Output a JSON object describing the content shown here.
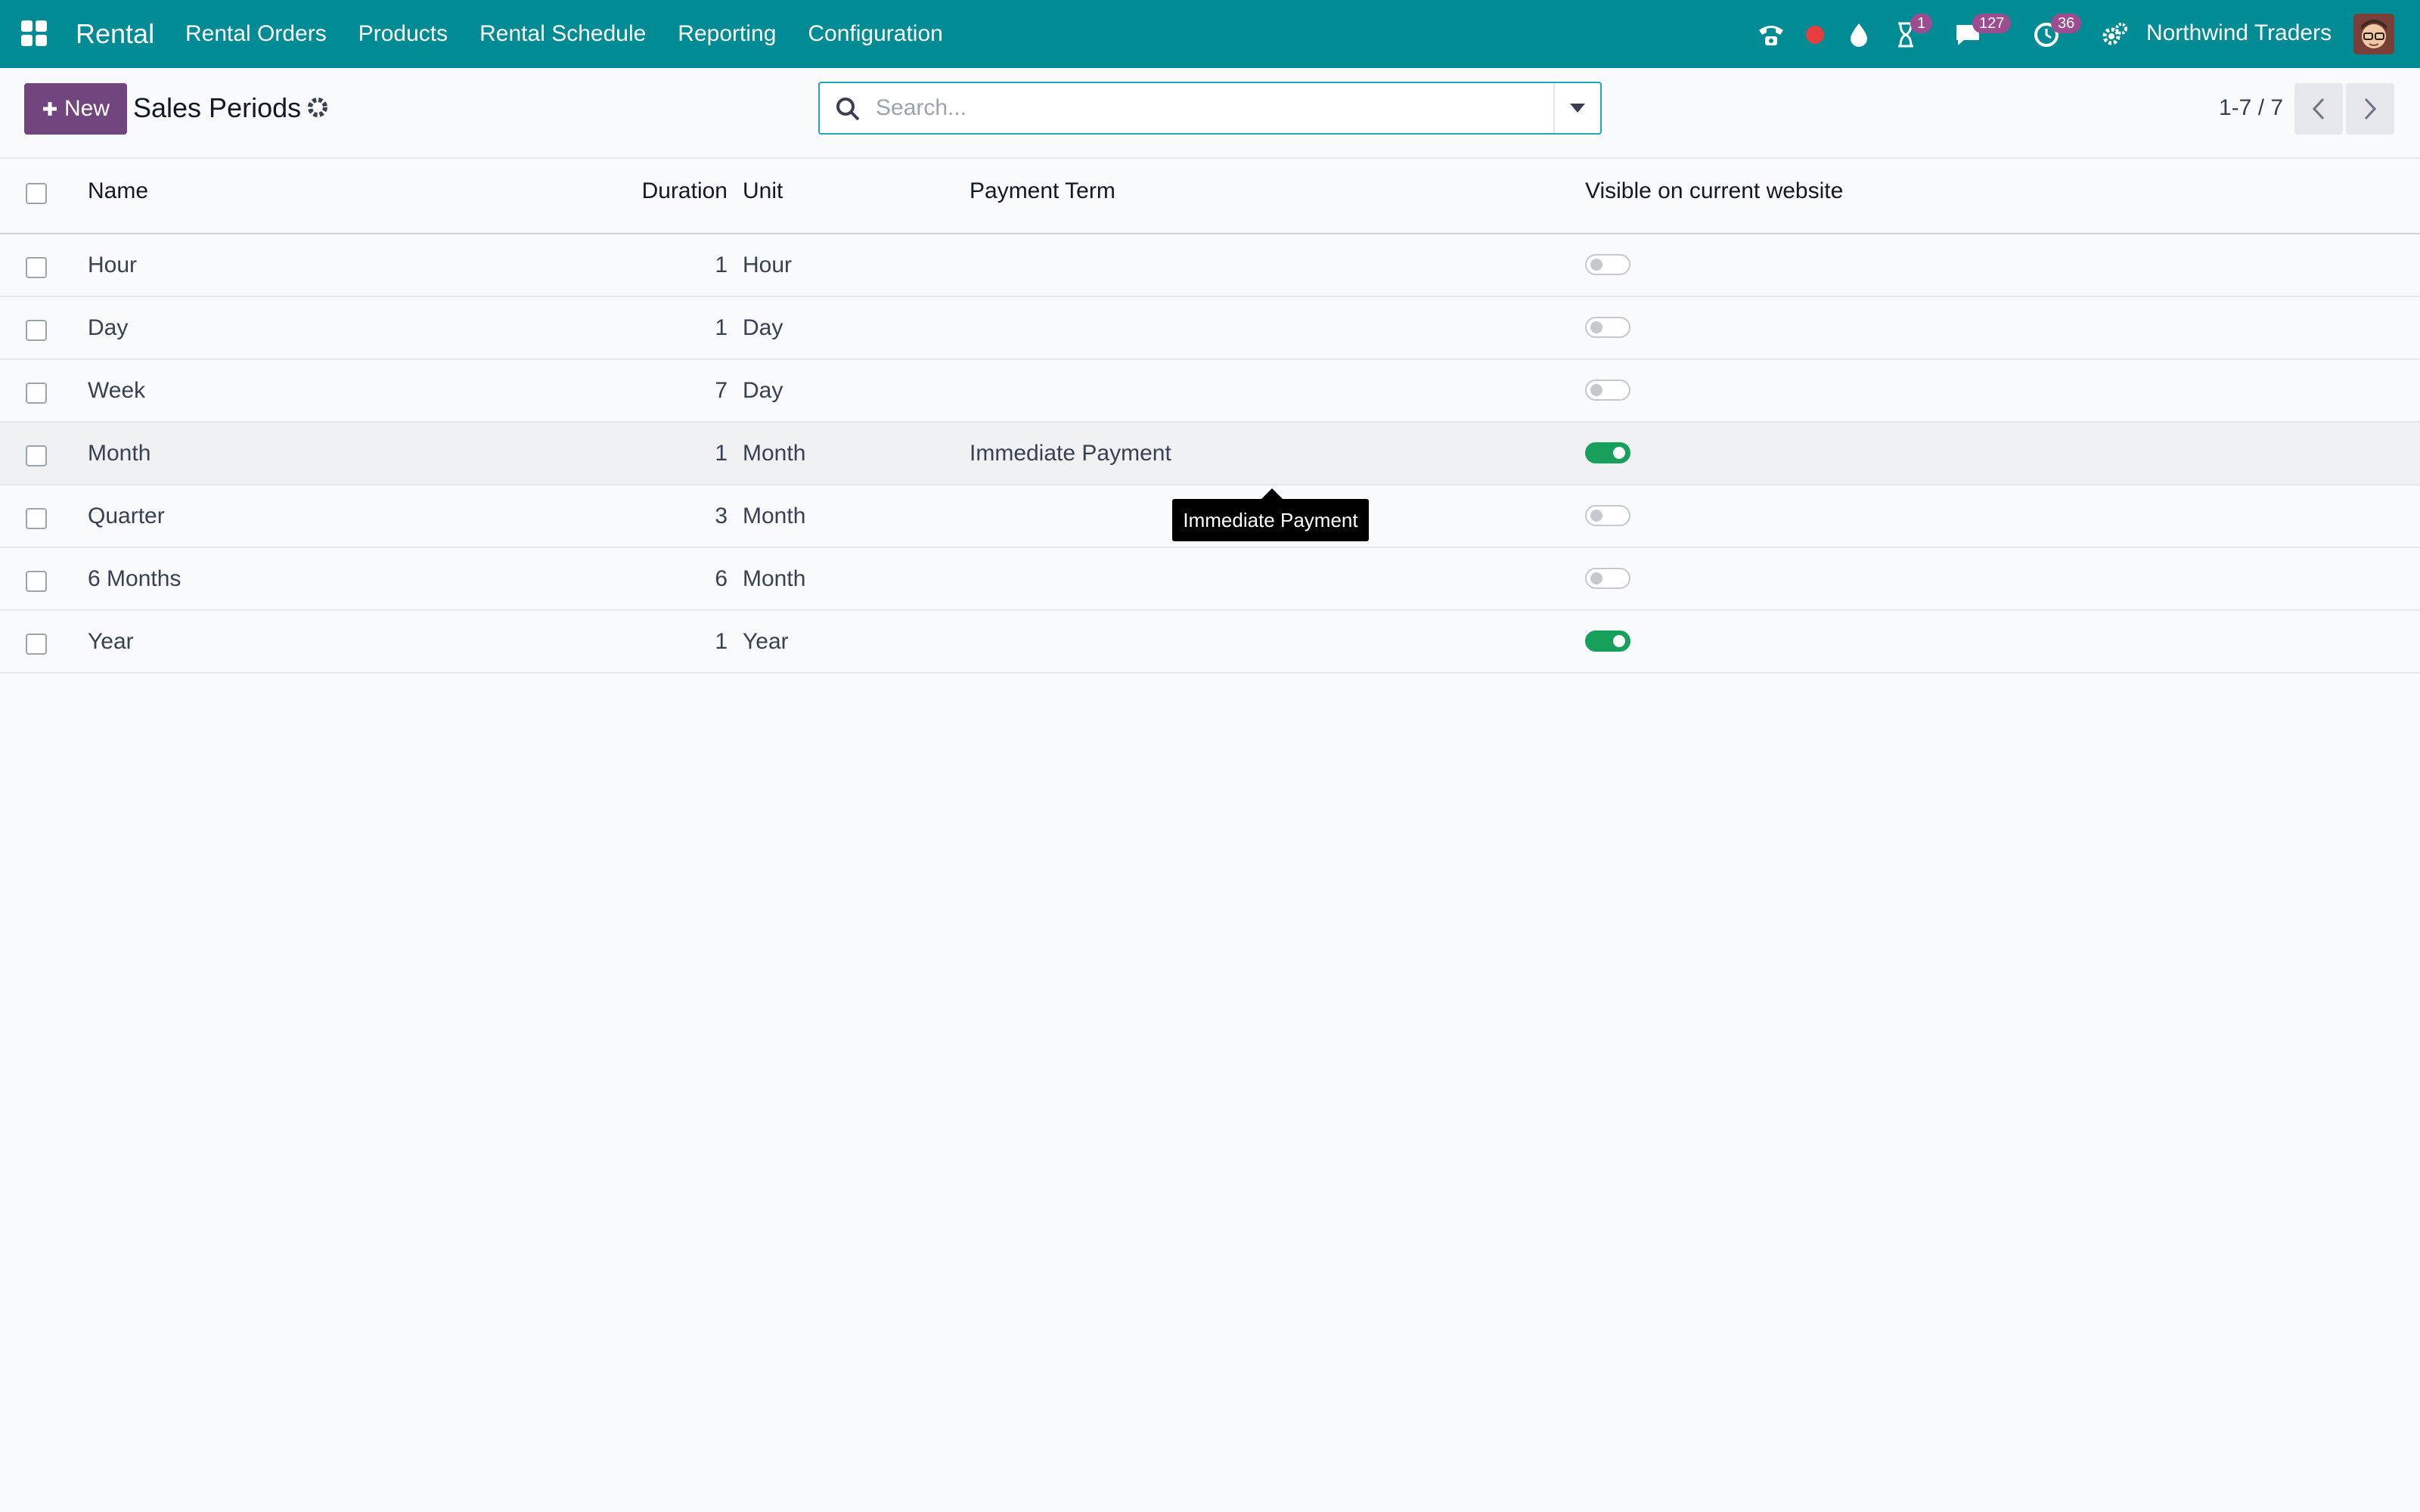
{
  "navbar": {
    "brand": "Rental",
    "menu": [
      "Rental Orders",
      "Products",
      "Rental Schedule",
      "Reporting",
      "Configuration"
    ],
    "badges": {
      "activities": "1",
      "messages": "127",
      "timers": "36"
    },
    "company": "Northwind Traders",
    "icons": [
      "apps-grid-icon",
      "phone-icon",
      "record-dot-icon",
      "droplet-icon",
      "hourglass-icon",
      "chat-icon",
      "clock-icon",
      "settings-gears-icon"
    ]
  },
  "control_panel": {
    "new_label": "New",
    "title": "Sales Periods",
    "search_placeholder": "Search...",
    "pager": "1-7 / 7"
  },
  "table": {
    "columns": {
      "name": "Name",
      "duration": "Duration",
      "unit": "Unit",
      "payment_term": "Payment Term",
      "visible": "Visible on current website"
    },
    "rows": [
      {
        "name": "Hour",
        "duration": "1",
        "unit": "Hour",
        "payment_term": "",
        "visible": false
      },
      {
        "name": "Day",
        "duration": "1",
        "unit": "Day",
        "payment_term": "",
        "visible": false
      },
      {
        "name": "Week",
        "duration": "7",
        "unit": "Day",
        "payment_term": "",
        "visible": false
      },
      {
        "name": "Month",
        "duration": "1",
        "unit": "Month",
        "payment_term": "Immediate Payment",
        "visible": true
      },
      {
        "name": "Quarter",
        "duration": "3",
        "unit": "Month",
        "payment_term": "",
        "visible": false
      },
      {
        "name": "6 Months",
        "duration": "6",
        "unit": "Month",
        "payment_term": "",
        "visible": false
      },
      {
        "name": "Year",
        "duration": "1",
        "unit": "Year",
        "payment_term": "",
        "visible": true
      }
    ]
  },
  "tooltip": {
    "text": "Immediate Payment"
  },
  "colors": {
    "navbar": "#018b95",
    "primary": "#71457e",
    "toggle_on": "#16a05c",
    "badge": "#9b4d8f"
  }
}
